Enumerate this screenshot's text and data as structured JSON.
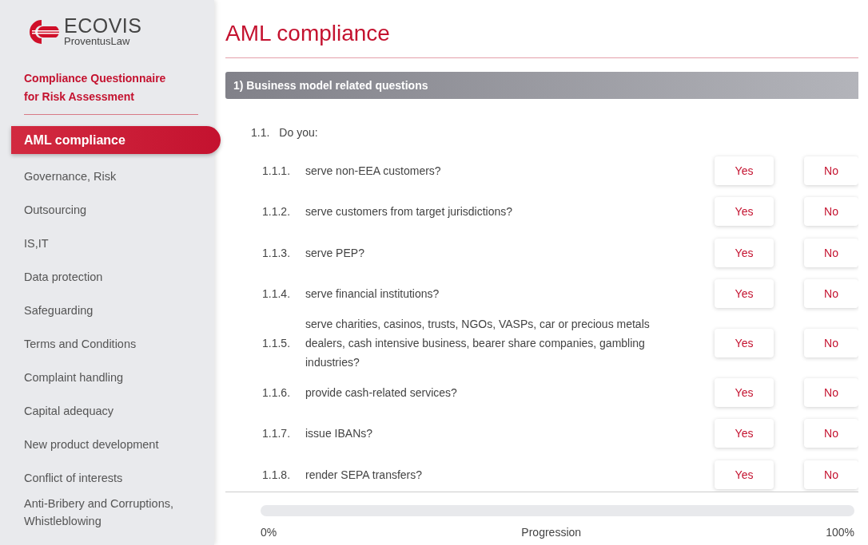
{
  "sidebar": {
    "logo": {
      "name": "ECOVIS",
      "sub": "ProventusLaw"
    },
    "subtitle": "Compliance Questionnaire for Risk Assessment",
    "items": [
      {
        "label": "AML compliance",
        "selected": true
      },
      {
        "label": "Governance, Risk",
        "selected": false
      },
      {
        "label": "Outsourcing",
        "selected": false
      },
      {
        "label": "IS,IT",
        "selected": false
      },
      {
        "label": "Data protection",
        "selected": false
      },
      {
        "label": "Safeguarding",
        "selected": false
      },
      {
        "label": "Terms and Conditions",
        "selected": false
      },
      {
        "label": "Complaint handling",
        "selected": false
      },
      {
        "label": "Capital adequacy",
        "selected": false
      },
      {
        "label": "New product development",
        "selected": false
      },
      {
        "label": "Conflict of interests",
        "selected": false
      },
      {
        "label": "Anti-Bribery and Corruptions, Whistleblowing",
        "selected": false
      }
    ]
  },
  "title": "AML compliance",
  "section": {
    "heading": "1) Business model related questions",
    "group": {
      "number": "1.1.",
      "text": "Do you:"
    },
    "questions": [
      {
        "number": "1.1.1.",
        "text": "serve non-EEA customers?",
        "options": [
          {
            "label": "Yes",
            "selected": false
          },
          {
            "label": "No",
            "selected": false
          }
        ]
      },
      {
        "number": "1.1.2.",
        "text": "serve customers from target jurisdictions?",
        "options": [
          {
            "label": "Yes",
            "selected": false
          },
          {
            "label": "No",
            "selected": false
          }
        ]
      },
      {
        "number": "1.1.3.",
        "text": "serve PEP?",
        "options": [
          {
            "label": "Yes",
            "selected": false
          },
          {
            "label": "No",
            "selected": false
          }
        ]
      },
      {
        "number": "1.1.4.",
        "text": "serve financial institutions?",
        "options": [
          {
            "label": "Yes",
            "selected": false
          },
          {
            "label": "No",
            "selected": false
          }
        ]
      },
      {
        "number": "1.1.5.",
        "text": "serve charities, casinos, trusts, NGOs, VASPs, car or precious metals dealers, cash intensive business, bearer share companies, gambling industries?",
        "options": [
          {
            "label": "Yes",
            "selected": false
          },
          {
            "label": "No",
            "selected": false
          }
        ]
      },
      {
        "number": "1.1.6.",
        "text": "provide cash-related services?",
        "options": [
          {
            "label": "Yes",
            "selected": false
          },
          {
            "label": "No",
            "selected": false
          }
        ]
      },
      {
        "number": "1.1.7.",
        "text": "issue IBANs?",
        "options": [
          {
            "label": "Yes",
            "selected": false
          },
          {
            "label": "No",
            "selected": false
          }
        ]
      },
      {
        "number": "1.1.8.",
        "text": "render SEPA transfers?",
        "options": [
          {
            "label": "Yes",
            "selected": false
          },
          {
            "label": "No",
            "selected": false
          }
        ]
      }
    ]
  },
  "progress": {
    "level": 0,
    "start": "0%",
    "label": "Progression",
    "end": "100%"
  }
}
